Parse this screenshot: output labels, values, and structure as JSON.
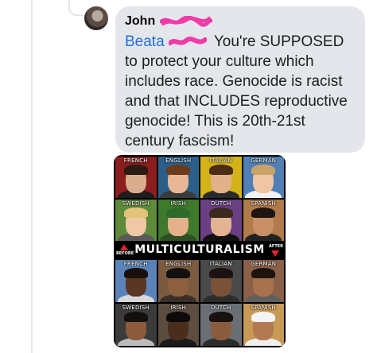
{
  "comment": {
    "author_visible": "John",
    "mention_visible": "Beata",
    "text": " You're SUPPOSED to protect your culture which includes race. Genocide is racist and that INCLUDES reproductive genocide! This is 20th-21st century fascism!",
    "redaction_color": "#f03ba8",
    "bubble_color": "#e4e6eb",
    "link_color": "#216fdb"
  },
  "meme": {
    "banner": "MULTICULTURALISM",
    "before_label": "BEFORE",
    "after_label": "AFTER",
    "top_rows": [
      [
        "FRENCH",
        "ENGLISH",
        "ITALIAN",
        "GERMAN"
      ],
      [
        "SWEDISH",
        "IRISH",
        "DUTCH",
        "SPANISH"
      ]
    ],
    "bottom_rows": [
      [
        "FRENCH",
        "ENGLISH",
        "ITALIAN",
        "GERMAN"
      ],
      [
        "SWEDISH",
        "IRISH",
        "DUTCH",
        "SPANISH"
      ]
    ],
    "arrow_color": "#e0242c"
  }
}
